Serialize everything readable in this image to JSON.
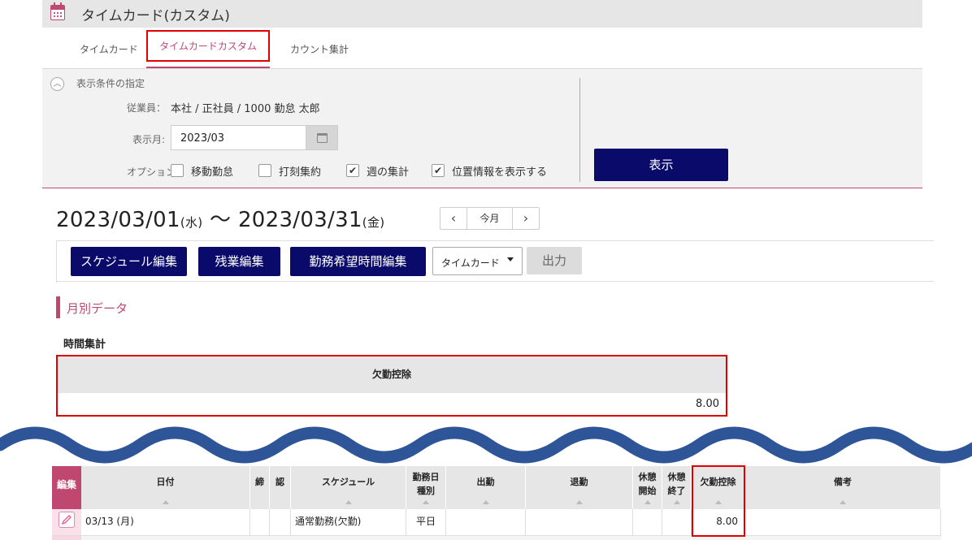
{
  "header": {
    "title": "タイムカード(カスタム)",
    "icon": "calendar-icon"
  },
  "tabs": [
    {
      "label": "タイムカード",
      "active": false
    },
    {
      "label": "タイムカードカスタム",
      "active": true
    },
    {
      "label": "カウント集計",
      "active": false
    }
  ],
  "conditions": {
    "title": "表示条件の指定",
    "employee_label": "従業員：",
    "employee_value": "本社 / 正社員 / 1000 勤怠 太郎",
    "month_label": "表示月:",
    "month_value": "2023/03",
    "options_label": "オプション:",
    "options": [
      {
        "label": "移動勤怠",
        "checked": false
      },
      {
        "label": "打刻集約",
        "checked": false
      },
      {
        "label": "週の集計",
        "checked": true
      },
      {
        "label": "位置情報を表示する",
        "checked": true
      }
    ],
    "show_button": "表示"
  },
  "range": {
    "start": "2023/03/01",
    "start_day": "(水)",
    "tilde": "〜",
    "end": "2023/03/31",
    "end_day": "(金)",
    "prev": "<",
    "today": "今月",
    "next": ">"
  },
  "toolbar": {
    "schedule_edit": "スケジュール編集",
    "overtime_edit": "残業編集",
    "request_edit": "勤務希望時間編集",
    "type_select": "タイムカード",
    "output": "出力"
  },
  "monthly": {
    "section_title": "月別データ",
    "time_summary_title": "時間集計",
    "column": "欠勤控除",
    "value": "8.00"
  },
  "table": {
    "edit_header": "編集",
    "headers": {
      "date": "日付",
      "close": "締",
      "approve": "認",
      "schedule": "スケジュール",
      "daytype_1": "勤務日",
      "daytype_2": "種別",
      "in": "出勤",
      "out": "退勤",
      "break_start_1": "休憩",
      "break_start_2": "開始",
      "break_end_1": "休憩",
      "break_end_2": "終了",
      "absence": "欠勤控除",
      "note": "備考"
    },
    "rows": [
      {
        "date": "03/13 (月)",
        "schedule": "通常勤務(欠勤)",
        "daytype": "平日",
        "absence": "8.00"
      }
    ]
  },
  "colors": {
    "navy": "#0a0a6b",
    "accent": "#c0476f",
    "highlight": "#e00000",
    "wave": "#2e5597"
  }
}
